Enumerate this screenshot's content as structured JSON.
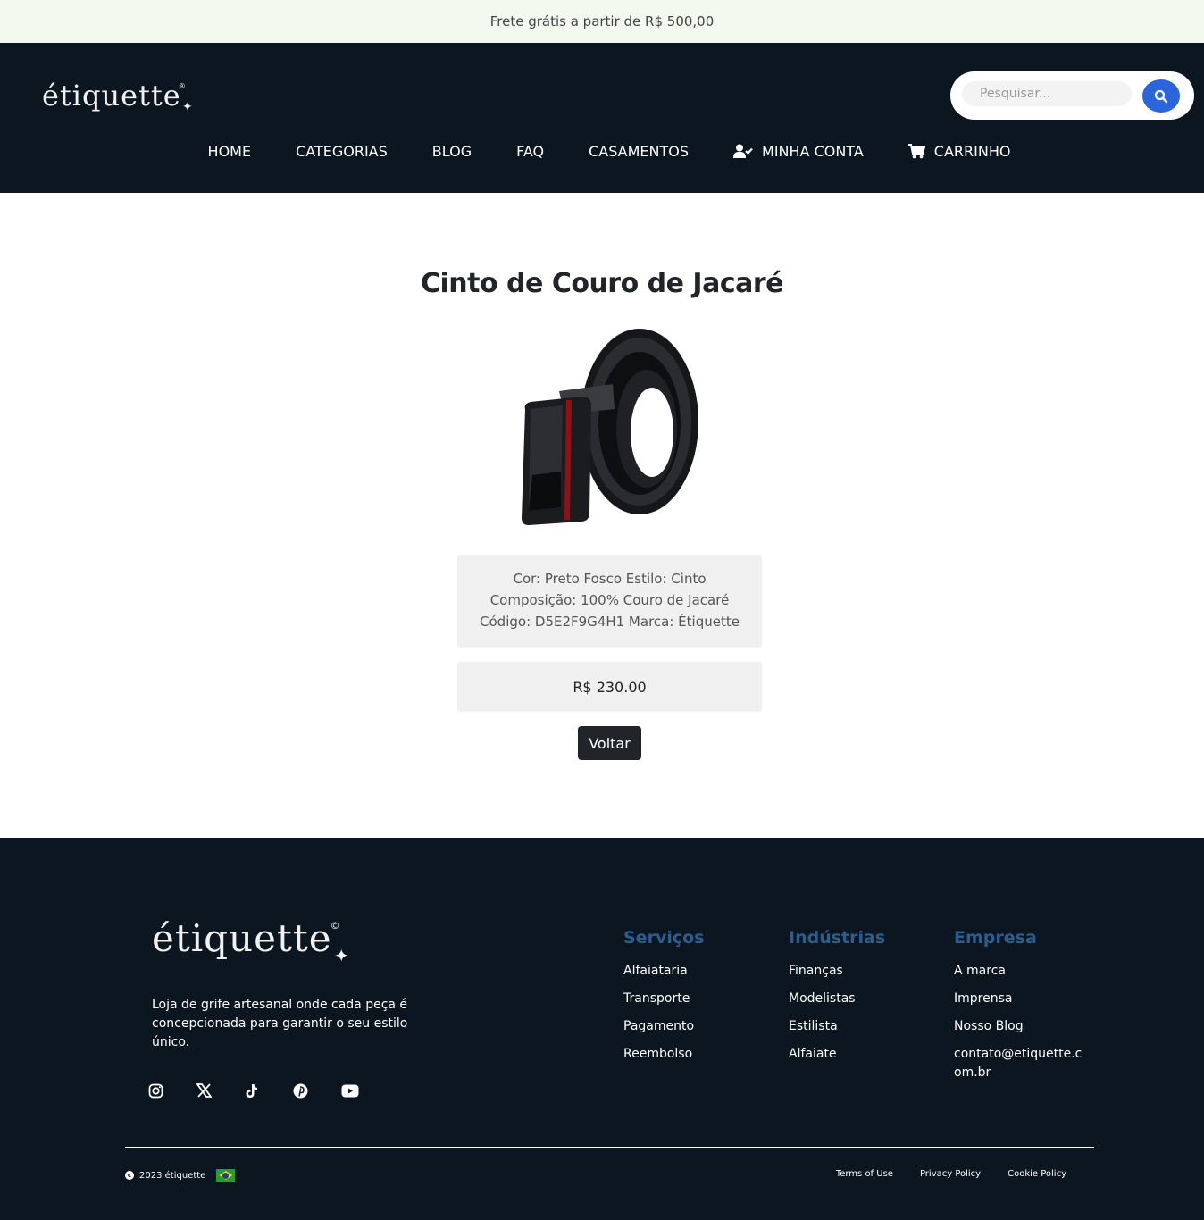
{
  "topbar": {
    "text": "Frete grátis a partir de R$ 500,00"
  },
  "header": {
    "logo": "étiquette",
    "search_placeholder": "Pesquisar...",
    "nav": [
      {
        "label": "HOME",
        "icon": ""
      },
      {
        "label": "CATEGORIAS",
        "icon": ""
      },
      {
        "label": "BLOG",
        "icon": ""
      },
      {
        "label": "FAQ",
        "icon": ""
      },
      {
        "label": "CASAMENTOS",
        "icon": ""
      },
      {
        "label": "MINHA CONTA",
        "icon": "user-check-icon"
      },
      {
        "label": "CARRINHO",
        "icon": "cart-icon"
      }
    ]
  },
  "product": {
    "title": "Cinto de Couro de Jacaré",
    "image": "black-leather-belt-image",
    "desc_line1": "Cor: Preto Fosco Estilo: Cinto",
    "desc_line2": "Composição: 100% Couro de Jacaré",
    "desc_line3": "Código: D5E2F9G4H1 Marca: Étiquette",
    "price": "R$ 230.00",
    "back_label": "Voltar"
  },
  "footer": {
    "logo": "étiquette",
    "tagline": "Loja de grife artesanal onde cada peça é concepcionada para garantir o seu estilo único.",
    "socials": [
      "instagram-icon",
      "x-icon",
      "tiktok-icon",
      "pinterest-icon",
      "youtube-icon"
    ],
    "columns": [
      {
        "heading": "Serviços",
        "links": [
          "Alfaiataria",
          "Transporte",
          "Pagamento",
          "Reembolso"
        ]
      },
      {
        "heading": "Indústrias",
        "links": [
          "Finanças",
          "Modelistas",
          "Estilista",
          "Alfaiate"
        ]
      },
      {
        "heading": "Empresa",
        "links": [
          "A marca",
          "Imprensa",
          "Nosso Blog",
          "contato@etiquette.com.br"
        ]
      }
    ],
    "copyright": "2023 étiquette",
    "legal": [
      "Terms of Use",
      "Privacy Policy",
      "Cookie Policy"
    ]
  },
  "colors": {
    "topbar_bg": "#f3f9ef",
    "header_bg": "#0c1620",
    "accent_blue": "#2a65d9",
    "footer_heading": "#2b5d8e",
    "button_dark": "#212529"
  }
}
